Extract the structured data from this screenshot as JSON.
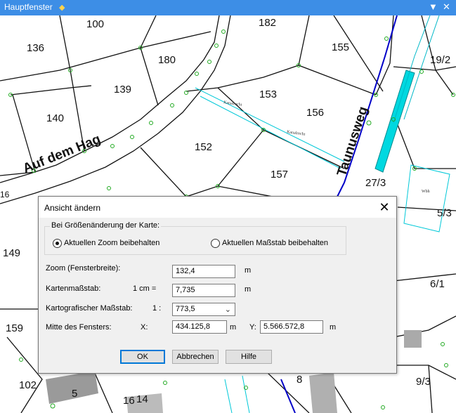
{
  "window": {
    "title": "Hauptfenster",
    "pin_icon": "pin-icon",
    "close_icon": "close-icon"
  },
  "map": {
    "plots": [
      "100",
      "182",
      "136",
      "180",
      "155",
      "19/2",
      "139",
      "153",
      "156",
      "140",
      "152",
      "157",
      "27/3",
      "5/3",
      "149",
      "6/1",
      "159",
      "102",
      "5",
      "8",
      "9/3",
      "16",
      "14"
    ],
    "edge_plot_partial": "16",
    "streets": [
      "Auf dem Hag",
      "Taunusweg"
    ],
    "annotations": [
      "Kanalrecht",
      "Kanalrecht",
      "Wbh"
    ]
  },
  "dialog": {
    "title": "Ansicht ändern",
    "group_label": "Bei Größenänderung der Karte:",
    "radio_keep_zoom": "Aktuellen Zoom beibehalten",
    "radio_keep_scale": "Aktuellen Maßstab beibehalten",
    "selected_radio": "radio_keep_zoom",
    "zoom_label": "Zoom (Fensterbreite):",
    "zoom_value": "132,4",
    "zoom_unit": "m",
    "scale_label": "Kartenmaßstab:",
    "scale_prefix": "1 cm =",
    "scale_value": "7,735",
    "scale_unit": "m",
    "carto_label": "Kartografischer Maßstab:",
    "carto_prefix": "1 :",
    "carto_value": "773,5",
    "center_label": "Mitte des Fensters:",
    "x_label": "X:",
    "x_value": "434.125,8",
    "x_unit": "m",
    "y_label": "Y:",
    "y_value": "5.566.572,8",
    "y_unit": "m",
    "ok": "OK",
    "cancel": "Abbrechen",
    "help": "Hilfe"
  },
  "colors": {
    "titlebar": "#3d8ee6",
    "accent_blue": "#0000c8",
    "cyan": "#00d8e0",
    "green_point": "#22aa22"
  }
}
